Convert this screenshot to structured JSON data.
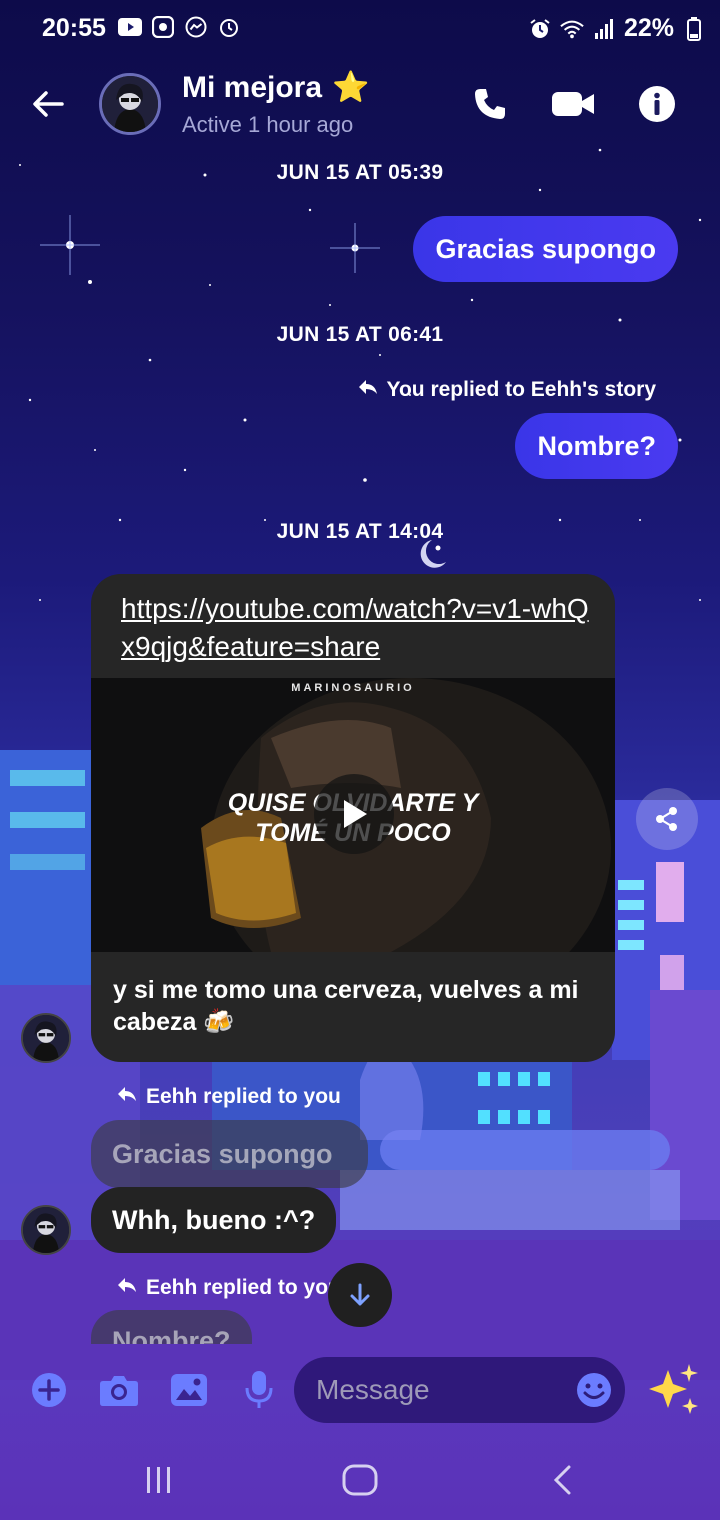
{
  "status_bar": {
    "time": "20:55",
    "battery": "22%"
  },
  "header": {
    "contact_name": "Mi mejora",
    "name_emoji": "⭐",
    "subtitle": "Active 1 hour ago"
  },
  "messages": {
    "ts1": "JUN 15 AT 05:39",
    "out1": "Gracias supongo",
    "ts2": "JUN 15 AT 06:41",
    "reply_note_out": "You replied to Eehh's story",
    "out2": "Nombre?",
    "ts3": "JUN 15 AT 14:04",
    "link_url": "https://youtube.com/watch?v=v1-whQx9qjg&feature=share",
    "video_brand": "MARINOSAURIO",
    "video_line1": "QUISE OLVIDARTE Y",
    "video_line2": "TOMÉ UN POCO",
    "link_caption": "y si me tomo una cerveza, vuelves a mi cabeza 🍻",
    "reply_note_in1": "Eehh replied to you",
    "quoted1": "Gracias supongo",
    "in1": "Whh, bueno :^?",
    "reply_note_in2": "Eehh replied to you",
    "quoted2": "Nombre?"
  },
  "composer": {
    "placeholder": "Message",
    "sparkle": "✨"
  },
  "colors": {
    "outgoing_bubble": "#3d35e6",
    "incoming_bubble": "#232323",
    "accent_icon": "#6b7cff"
  },
  "icons": {
    "status_left": [
      "youtube-icon",
      "app-icon",
      "messenger-icon",
      "alarm-icon"
    ],
    "status_right": [
      "alarm-icon",
      "wifi-icon",
      "signal-icon",
      "battery-icon"
    ],
    "header": [
      "back-arrow-icon",
      "phone-icon",
      "video-call-icon",
      "info-icon"
    ],
    "composer": [
      "plus-icon",
      "camera-icon",
      "gallery-icon",
      "microphone-icon",
      "emoji-icon"
    ],
    "navigation": [
      "recent-apps-icon",
      "home-icon",
      "back-icon"
    ]
  }
}
